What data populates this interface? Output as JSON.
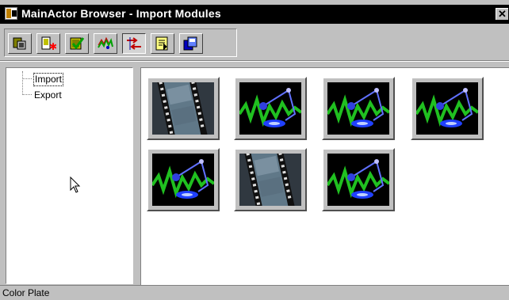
{
  "window": {
    "title": "MainActor Browser - Import Modules",
    "close_glyph": "✕"
  },
  "toolbar": {
    "buttons": [
      {
        "icon": "modules-icon",
        "pressed": false
      },
      {
        "icon": "import-star-icon",
        "pressed": false
      },
      {
        "icon": "check-icon",
        "pressed": false
      },
      {
        "icon": "effects-icon",
        "pressed": false
      },
      {
        "icon": "transition-arrows-icon",
        "pressed": true
      },
      {
        "icon": "export-doc-icon",
        "pressed": false
      },
      {
        "icon": "copy-pages-icon",
        "pressed": false
      }
    ]
  },
  "tree": {
    "items": [
      {
        "label": "Import",
        "selected": true
      },
      {
        "label": "Export",
        "selected": false
      }
    ]
  },
  "thumbnails": [
    {
      "kind": "film"
    },
    {
      "kind": "wave"
    },
    {
      "kind": "wave"
    },
    {
      "kind": "wave"
    },
    {
      "kind": "wave"
    },
    {
      "kind": "film"
    },
    {
      "kind": "wave"
    }
  ],
  "status": {
    "text": "Color Plate"
  },
  "colors": {
    "titlebar": "#000000",
    "face": "#c0c0c0",
    "wave_green": "#20c020",
    "wave_blue": "#2040ff"
  }
}
